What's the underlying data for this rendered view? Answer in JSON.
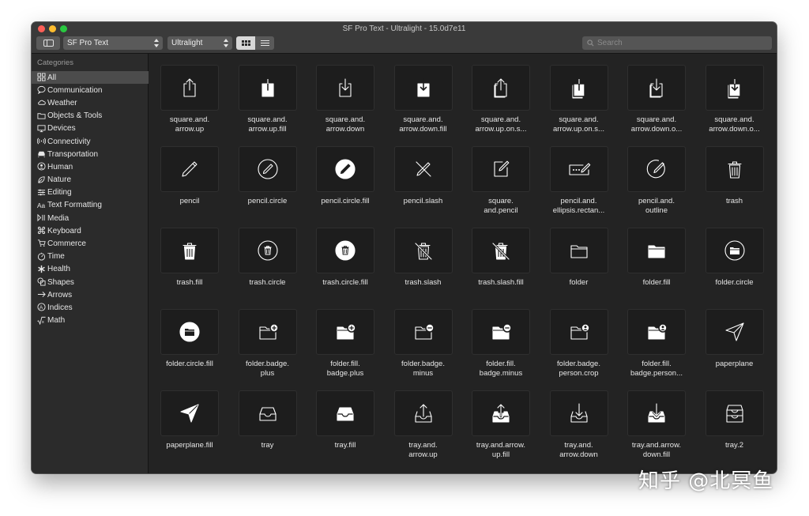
{
  "window": {
    "title": "SF Pro Text - Ultralight - 15.0d7e11"
  },
  "toolbar": {
    "font": "SF Pro Text",
    "weight": "Ultralight",
    "search_placeholder": "Search"
  },
  "sidebar": {
    "heading": "Categories",
    "items": [
      {
        "label": "All",
        "icon": "grid",
        "selected": true
      },
      {
        "label": "Communication",
        "icon": "bubble"
      },
      {
        "label": "Weather",
        "icon": "cloud"
      },
      {
        "label": "Objects & Tools",
        "icon": "folder"
      },
      {
        "label": "Devices",
        "icon": "display"
      },
      {
        "label": "Connectivity",
        "icon": "antenna"
      },
      {
        "label": "Transportation",
        "icon": "car"
      },
      {
        "label": "Human",
        "icon": "person-circle"
      },
      {
        "label": "Nature",
        "icon": "leaf"
      },
      {
        "label": "Editing",
        "icon": "sliders"
      },
      {
        "label": "Text Formatting",
        "icon": "textformat"
      },
      {
        "label": "Media",
        "icon": "playpause"
      },
      {
        "label": "Keyboard",
        "icon": "command"
      },
      {
        "label": "Commerce",
        "icon": "cart"
      },
      {
        "label": "Time",
        "icon": "timer"
      },
      {
        "label": "Health",
        "icon": "staroflife"
      },
      {
        "label": "Shapes",
        "icon": "shapes"
      },
      {
        "label": "Arrows",
        "icon": "arrow-right"
      },
      {
        "label": "Indices",
        "icon": "a-circle"
      },
      {
        "label": "Math",
        "icon": "sqrt"
      }
    ]
  },
  "symbols": [
    {
      "name": "square.and.\narrow.up",
      "icon": "square-and-arrow-up"
    },
    {
      "name": "square.and.\narrow.up.fill",
      "icon": "square-and-arrow-up-fill"
    },
    {
      "name": "square.and.\narrow.down",
      "icon": "square-and-arrow-down"
    },
    {
      "name": "square.and.\narrow.down.fill",
      "icon": "square-and-arrow-down-fill"
    },
    {
      "name": "square.and.\narrow.up.on.s...",
      "icon": "square-and-arrow-up-on-square"
    },
    {
      "name": "square.and.\narrow.up.on.s...",
      "icon": "square-and-arrow-up-on-square-fill"
    },
    {
      "name": "square.and.\narrow.down.o...",
      "icon": "square-and-arrow-down-on-square"
    },
    {
      "name": "square.and.\narrow.down.o...",
      "icon": "square-and-arrow-down-on-square-fill"
    },
    {
      "name": "pencil",
      "icon": "pencil"
    },
    {
      "name": "pencil.circle",
      "icon": "pencil-circle"
    },
    {
      "name": "pencil.circle.fill",
      "icon": "pencil-circle-fill"
    },
    {
      "name": "pencil.slash",
      "icon": "pencil-slash"
    },
    {
      "name": "square.\nand.pencil",
      "icon": "square-and-pencil"
    },
    {
      "name": "pencil.and.\nellipsis.rectan...",
      "icon": "pencil-and-ellipsis-rectangle"
    },
    {
      "name": "pencil.and.\noutline",
      "icon": "pencil-and-outline"
    },
    {
      "name": "trash",
      "icon": "trash"
    },
    {
      "name": "trash.fill",
      "icon": "trash-fill"
    },
    {
      "name": "trash.circle",
      "icon": "trash-circle"
    },
    {
      "name": "trash.circle.fill",
      "icon": "trash-circle-fill"
    },
    {
      "name": "trash.slash",
      "icon": "trash-slash"
    },
    {
      "name": "trash.slash.fill",
      "icon": "trash-slash-fill"
    },
    {
      "name": "folder",
      "icon": "folder"
    },
    {
      "name": "folder.fill",
      "icon": "folder-fill"
    },
    {
      "name": "folder.circle",
      "icon": "folder-circle"
    },
    {
      "name": "folder.circle.fill",
      "icon": "folder-circle-fill"
    },
    {
      "name": "folder.badge.\nplus",
      "icon": "folder-badge-plus"
    },
    {
      "name": "folder.fill.\nbadge.plus",
      "icon": "folder-fill-badge-plus"
    },
    {
      "name": "folder.badge.\nminus",
      "icon": "folder-badge-minus"
    },
    {
      "name": "folder.fill.\nbadge.minus",
      "icon": "folder-fill-badge-minus"
    },
    {
      "name": "folder.badge.\nperson.crop",
      "icon": "folder-badge-person-crop"
    },
    {
      "name": "folder.fill.\nbadge.person...",
      "icon": "folder-fill-badge-person-crop"
    },
    {
      "name": "paperplane",
      "icon": "paperplane"
    },
    {
      "name": "paperplane.fill",
      "icon": "paperplane-fill"
    },
    {
      "name": "tray",
      "icon": "tray"
    },
    {
      "name": "tray.fill",
      "icon": "tray-fill"
    },
    {
      "name": "tray.and.\narrow.up",
      "icon": "tray-and-arrow-up"
    },
    {
      "name": "tray.and.arrow.\nup.fill",
      "icon": "tray-and-arrow-up-fill"
    },
    {
      "name": "tray.and.\narrow.down",
      "icon": "tray-and-arrow-down"
    },
    {
      "name": "tray.and.arrow.\ndown.fill",
      "icon": "tray-and-arrow-down-fill"
    },
    {
      "name": "tray.2",
      "icon": "tray-2"
    }
  ],
  "watermark": "知乎 @北冥鱼",
  "colors": {
    "window_bg": "#232323",
    "sidebar_bg": "#2b2b2b",
    "selected_row": "#4c4c4c",
    "tile_bg": "#1d1d1d",
    "glyph": "#ffffff"
  }
}
